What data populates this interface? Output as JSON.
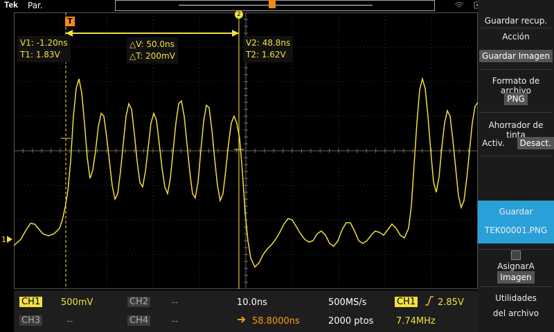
{
  "topbar": {
    "logo": "Tek",
    "mode": "Par.",
    "icons": [
      "wifi-icon",
      "network-icon",
      "export-icon",
      "help-icon"
    ]
  },
  "cursors": {
    "left": {
      "v_label": "V1: -1.20ns",
      "t_label": "T1: 1.83V"
    },
    "delta": {
      "v_label": "△V: 50.0ns",
      "t_label": "△T: 200mV"
    },
    "right": {
      "v_label": "V2: 48.8ns",
      "t_label": "T2: 1.62V"
    }
  },
  "markers": {
    "trigger": "T",
    "ch1_ground": "1",
    "cursor_badge": "2"
  },
  "menu": {
    "title": "Guardar recup.",
    "accion_label": "Acción",
    "accion_value": "Guardar Imagen",
    "formato_label": "Formato de archivo",
    "formato_value": "PNG",
    "ahorrador_label": "Ahorrador de tinta",
    "ahorrador_on": "Activ.",
    "ahorrador_off": "Desact.",
    "save_label": "Guardar",
    "save_file": "TEK00001.PNG",
    "asignar_label": "AsignarA",
    "asignar_value": "Imagen",
    "utilidades_line1": "Utilidades",
    "utilidades_line2": "del archivo"
  },
  "bottom": {
    "ch1": "CH1",
    "ch1_scale": "500mV",
    "ch2": "CH2",
    "ch2_scale": "--",
    "ch3": "CH3",
    "ch3_scale": "--",
    "ch4": "CH4",
    "ch4_scale": "--",
    "timebase": "10.0ns",
    "sample_rate": "500MS/s",
    "delay": "58.8000ns",
    "record": "2000 ptos",
    "trigger_ch": "CH1",
    "trigger_level": "2.85V",
    "frequency": "7.74MHz"
  },
  "colors": {
    "ch1": "#f2e040",
    "accent": "#2aa0d8",
    "delay": "#ff9a1a"
  }
}
